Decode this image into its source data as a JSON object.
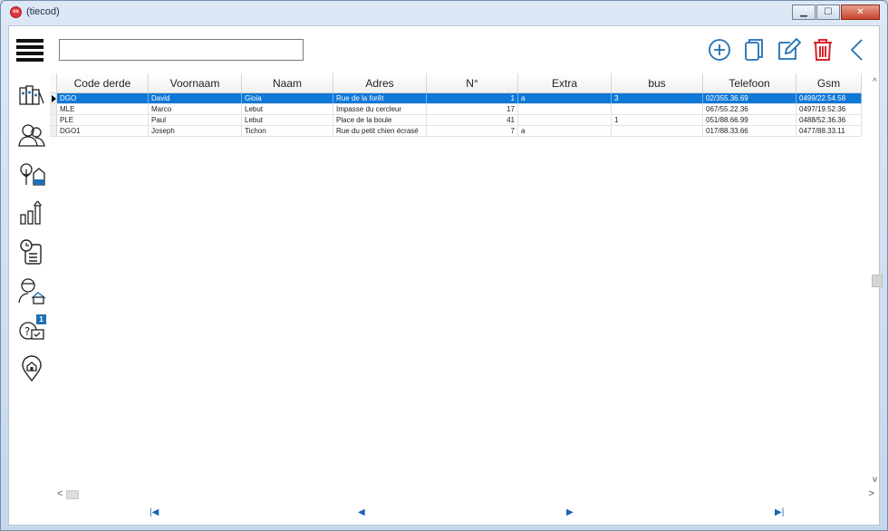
{
  "window": {
    "title": "(tiecod)",
    "app_icon_text": "ox"
  },
  "toolbar": {
    "search_value": "",
    "icons": [
      "add-icon",
      "copy-icon",
      "edit-icon",
      "delete-icon",
      "back-icon"
    ]
  },
  "sidenav": {
    "items": [
      {
        "name": "documents-icon"
      },
      {
        "name": "users-icon"
      },
      {
        "name": "properties-icon"
      },
      {
        "name": "statistics-icon"
      },
      {
        "name": "agenda-icon"
      },
      {
        "name": "agent-icon"
      },
      {
        "name": "requests-icon",
        "badge": "1"
      },
      {
        "name": "location-icon"
      }
    ]
  },
  "grid": {
    "columns": [
      "Code derde",
      "Voornaam",
      "Naam",
      "Adres",
      "N°",
      "Extra",
      "bus",
      "Telefoon",
      "Gsm"
    ],
    "rows": [
      {
        "code": "DGO",
        "voornaam": "David",
        "naam": "Gioia",
        "adres": "Rue de la forêt",
        "nr": "1",
        "extra": "a",
        "bus": "3",
        "telefoon": "02/355.36.69",
        "gsm": "0499/22.54.58",
        "selected": true
      },
      {
        "code": "MLE",
        "voornaam": "Marco",
        "naam": "Lebut",
        "adres": "Impasse du cercleur",
        "nr": "17",
        "extra": "",
        "bus": "",
        "telefoon": "067/55.22.36",
        "gsm": "0497/19.52.36",
        "selected": false
      },
      {
        "code": "PLE",
        "voornaam": "Paul",
        "naam": "Lebut",
        "adres": "Place de la boule",
        "nr": "41",
        "extra": "",
        "bus": "1",
        "telefoon": "051/88.66.99",
        "gsm": "0488/52.36.36",
        "selected": false
      },
      {
        "code": "DGO1",
        "voornaam": "Joseph",
        "naam": "Tichon",
        "adres": "Rue du petit chien écrasé",
        "nr": "7",
        "extra": "a",
        "bus": "",
        "telefoon": "017/88.33.66",
        "gsm": "0477/88.33.11",
        "selected": false
      }
    ]
  },
  "pager": {
    "first": "⏮",
    "prev": "◀",
    "next": "▶",
    "last": "⏭"
  },
  "colors": {
    "selection": "#0f78d7",
    "icon_blue": "#1f6fb4",
    "delete_red": "#d8232a"
  }
}
